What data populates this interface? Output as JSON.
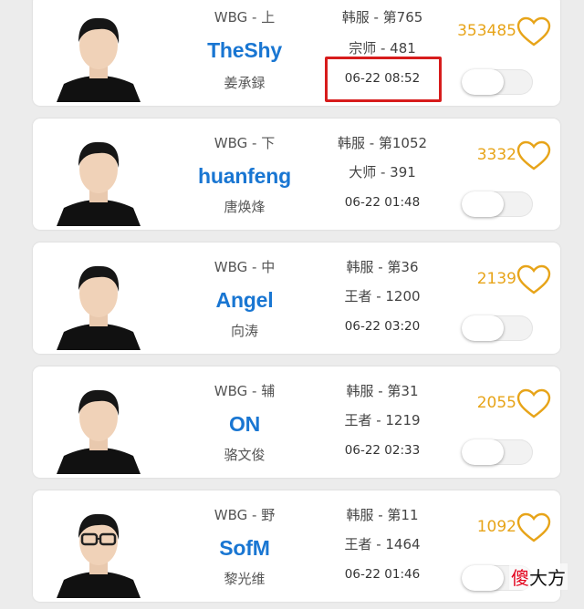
{
  "players": [
    {
      "team_position": "WBG - 上",
      "name": "TheShy",
      "real_name": "姜承録",
      "server_rank": "韩服 - 第765",
      "tier": "宗师 - 481",
      "time": "06-22 08:52",
      "likes": "353485",
      "toggle_on": false,
      "highlighted": true
    },
    {
      "team_position": "WBG - 下",
      "name": "huanfeng",
      "real_name": "唐焕烽",
      "server_rank": "韩服 - 第1052",
      "tier": "大师 - 391",
      "time": "06-22 01:48",
      "likes": "3332",
      "toggle_on": false,
      "highlighted": false
    },
    {
      "team_position": "WBG - 中",
      "name": "Angel",
      "real_name": "向涛",
      "server_rank": "韩服 - 第36",
      "tier": "王者 - 1200",
      "time": "06-22 03:20",
      "likes": "2139",
      "toggle_on": false,
      "highlighted": false
    },
    {
      "team_position": "WBG - 辅",
      "name": "ON",
      "real_name": "骆文俊",
      "server_rank": "韩服 - 第31",
      "tier": "王者 - 1219",
      "time": "06-22 02:33",
      "likes": "2055",
      "toggle_on": false,
      "highlighted": false
    },
    {
      "team_position": "WBG - 野",
      "name": "SofM",
      "real_name": "黎光维",
      "server_rank": "韩服 - 第11",
      "tier": "王者 - 1464",
      "time": "06-22 01:46",
      "likes": "1092",
      "toggle_on": false,
      "highlighted": false
    }
  ],
  "watermark": {
    "first_char": "傻",
    "rest": "大方"
  },
  "colors": {
    "name": "#1976d2",
    "likes": "#e7a419",
    "highlight": "#d71c1c"
  }
}
